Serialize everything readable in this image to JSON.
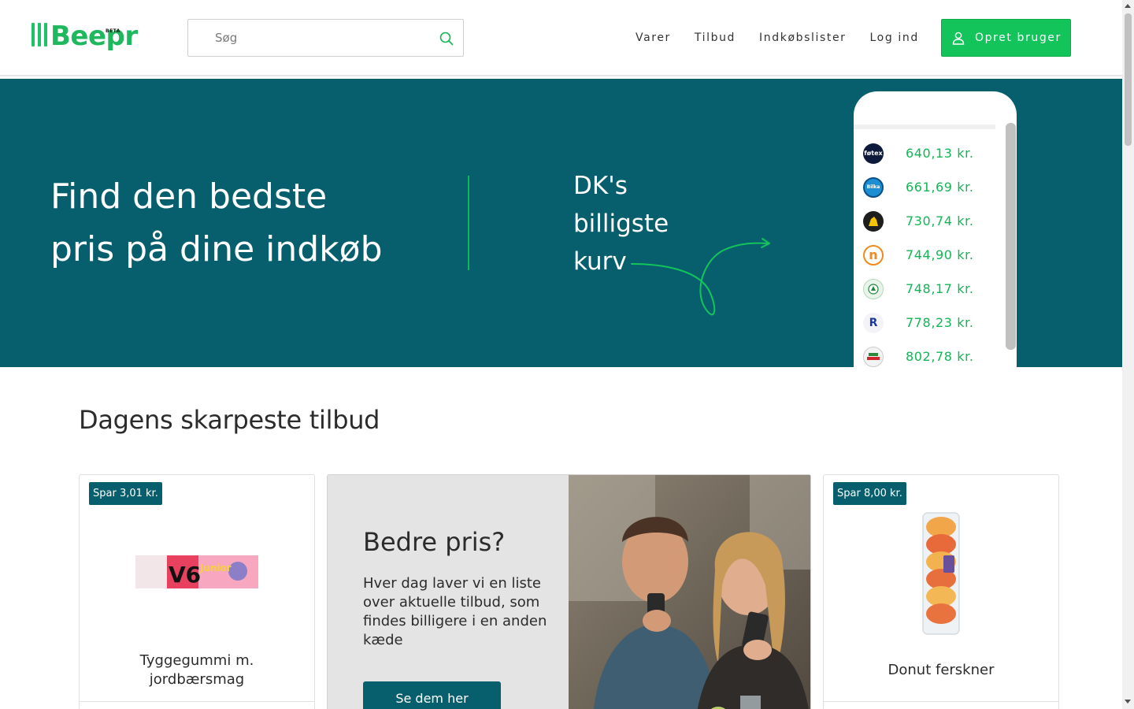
{
  "header": {
    "logo_text": "Beepr",
    "logo_badge": "BETA",
    "search_placeholder": "Søg",
    "nav": [
      "Varer",
      "Tilbud",
      "Indkøbslister",
      "Log ind"
    ],
    "signup_label": "Opret bruger"
  },
  "hero": {
    "title_line1": "Find den bedste",
    "title_line2": "pris på dine indkøb",
    "sub_line1": "DK's",
    "sub_line2": "billigste",
    "sub_line3": "kurv",
    "stores": [
      {
        "icon": "foetex-logo-icon",
        "logo_text": "føtex",
        "price": "640,13 kr."
      },
      {
        "icon": "bilka-logo-icon",
        "logo_text": "Bilka",
        "price": "661,69 kr."
      },
      {
        "icon": "netto-logo-icon",
        "logo_text": "",
        "price": "730,74 kr."
      },
      {
        "icon": "nemlig-logo-icon",
        "logo_text": "n",
        "price": "744,90 kr."
      },
      {
        "icon": "spar-logo-icon",
        "logo_text": "",
        "price": "748,17 kr."
      },
      {
        "icon": "rema-logo-icon",
        "logo_text": "R",
        "price": "778,23 kr."
      },
      {
        "icon": "meny-logo-icon",
        "logo_text": "",
        "price": "802,78 kr."
      }
    ]
  },
  "offers": {
    "section_title": "Dagens skarpeste tilbud",
    "left_card": {
      "badge": "Spar 3,01 kr.",
      "name": "Tyggegummi m. jordbærsmag",
      "product_text": "V6",
      "product_sub": "Junior"
    },
    "promo": {
      "title": "Bedre pris?",
      "text": "Hver dag laver vi en liste over aktuelle tilbud, som findes billigere i en anden kæde",
      "button": "Se dem her"
    },
    "right_card": {
      "badge": "Spar 8,00 kr.",
      "name": "Donut ferskner"
    }
  },
  "colors": {
    "brand_green": "#13c45a",
    "hero_teal": "#075f6e",
    "price_green": "#13b555"
  }
}
